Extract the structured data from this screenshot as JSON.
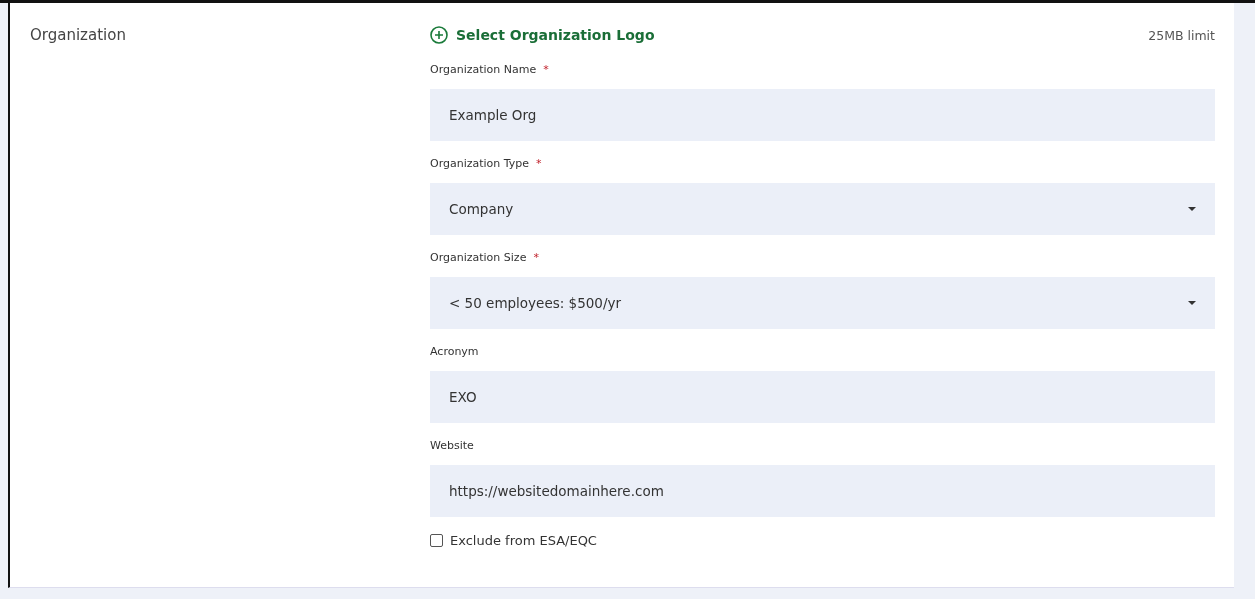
{
  "section": {
    "title": "Organization"
  },
  "logo": {
    "label": "Select Organization Logo",
    "limit": "25MB limit"
  },
  "fields": [
    {
      "label": "Organization Name",
      "required": true,
      "kind": "text",
      "value": "Example Org"
    },
    {
      "label": "Organization Type",
      "required": true,
      "kind": "select",
      "value": "Company"
    },
    {
      "label": "Organization Size",
      "required": true,
      "kind": "select",
      "value": "< 50 employees: $500/yr"
    },
    {
      "label": "Acronym",
      "required": false,
      "kind": "text",
      "value": "EXO"
    },
    {
      "label": "Website",
      "required": false,
      "kind": "text",
      "value": "https://websitedomainhere.com"
    }
  ],
  "required_mark": "*",
  "exclude": {
    "label": "Exclude from ESA/EQC",
    "checked": false
  }
}
